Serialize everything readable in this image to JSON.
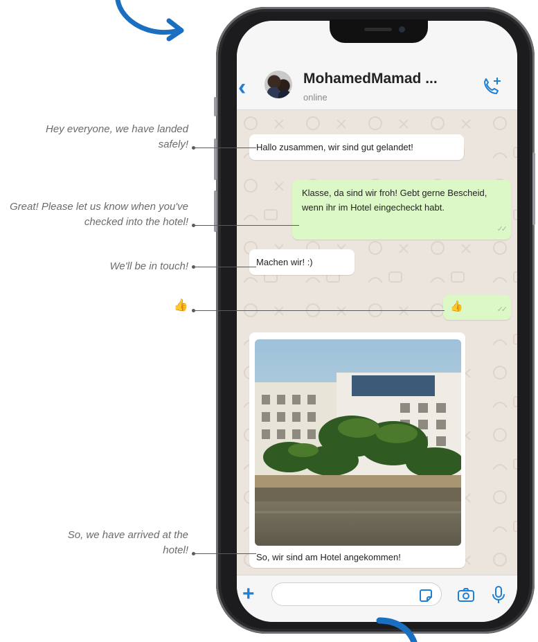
{
  "chat": {
    "contact_name": "MohamedMamad ...",
    "status": "online",
    "messages": [
      {
        "side": "in",
        "text": "Hallo zusammen, wir sind gut gelandet!"
      },
      {
        "side": "out",
        "text": "Klasse, da sind wir froh! Gebt gerne Bescheid, wenn ihr im Hotel eingecheckt habt."
      },
      {
        "side": "in",
        "text": "Machen wir! :)"
      },
      {
        "side": "out",
        "text": "👍"
      },
      {
        "side": "in",
        "text": "So, wir sind am Hotel angekommen!"
      }
    ],
    "input": {
      "placeholder": ""
    }
  },
  "annotations": {
    "a1": "Hey everyone, we have landed safely!",
    "a2": "Great! Please let us know when you've checked into the hotel!",
    "a3": "We'll be in touch!",
    "a4": "👍",
    "a5": "So, we have arrived at the hotel!"
  },
  "icons": {
    "back": "chevron-left-icon",
    "call": "phone-plus-icon",
    "plus": "plus-icon",
    "sticker": "sticker-icon",
    "camera": "camera-icon",
    "mic": "microphone-icon"
  },
  "colors": {
    "accent": "#1f7fd4",
    "outgoing_bubble": "#dcf8c6",
    "chat_background": "#ece5dd",
    "arrow": "#1a6fc0"
  }
}
